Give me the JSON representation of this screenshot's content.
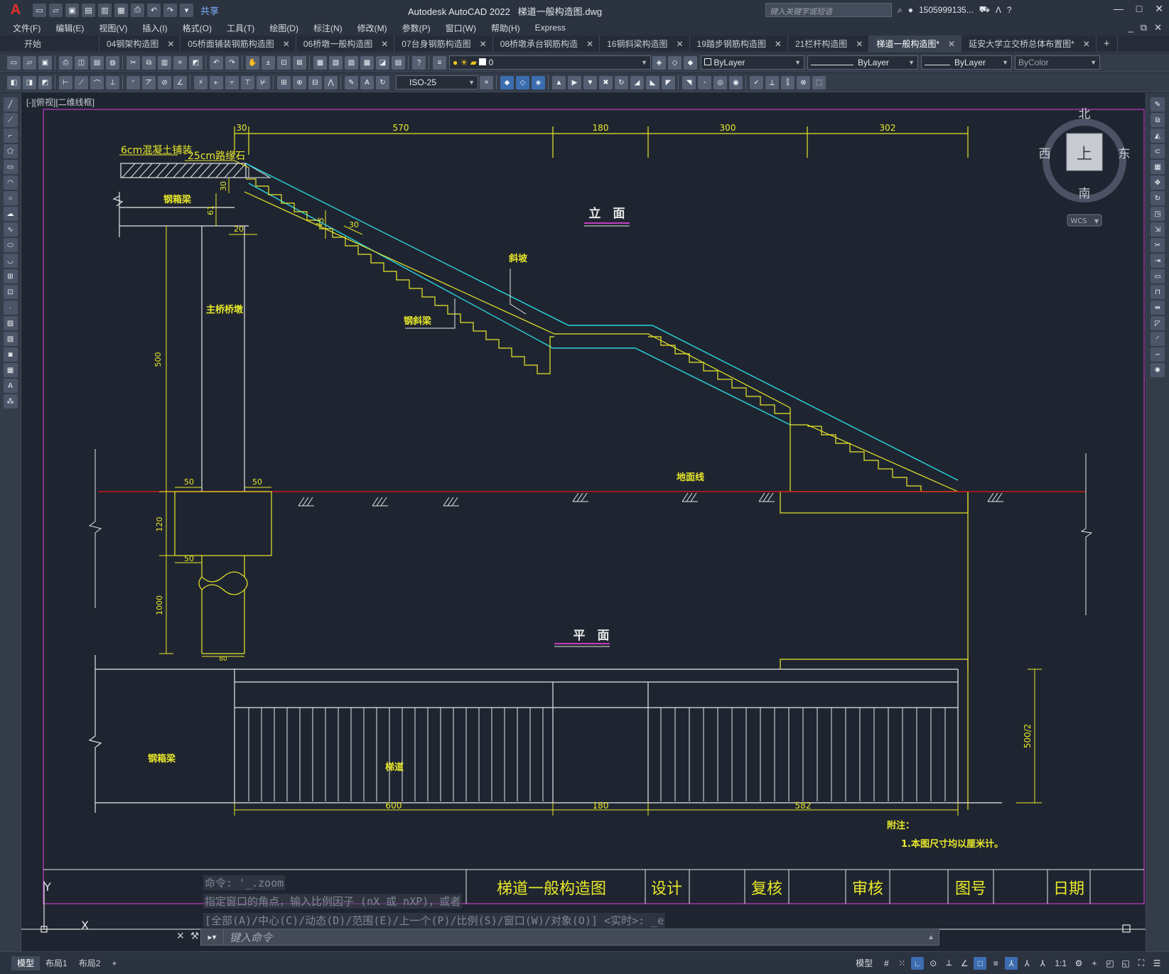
{
  "app": {
    "logo": "A",
    "title": "Autodesk AutoCAD 2022",
    "filename": "梯道一般构造图.dwg",
    "share_label": "共享",
    "search_placeholder": "键入关键字或短语",
    "user": "1505999135...",
    "window_controls": [
      "—",
      "□",
      "✕"
    ]
  },
  "menus": [
    "文件(F)",
    "编辑(E)",
    "视图(V)",
    "插入(I)",
    "格式(O)",
    "工具(T)",
    "绘图(D)",
    "标注(N)",
    "修改(M)",
    "参数(P)",
    "窗口(W)",
    "帮助(H)",
    "Express"
  ],
  "menu_right": [
    "_",
    "⧉",
    "✕"
  ],
  "tabs": [
    {
      "label": "开始",
      "closable": false
    },
    {
      "label": "04钢架构造图",
      "closable": true
    },
    {
      "label": "05桥面铺装钢筋构造图",
      "closable": true
    },
    {
      "label": "06桥墩一般构造图",
      "closable": true
    },
    {
      "label": "07台身钢筋构造图",
      "closable": true
    },
    {
      "label": "08桥墩承台钢筋构造",
      "closable": true
    },
    {
      "label": "16钢斜梁构造图",
      "closable": true
    },
    {
      "label": "19踏步钢筋构造图",
      "closable": true
    },
    {
      "label": "21栏杆构造图",
      "closable": true
    },
    {
      "label": "梯道一般构造图*",
      "closable": true,
      "active": true
    },
    {
      "label": "延安大学立交桥总体布置图*",
      "closable": true
    }
  ],
  "tab_add": "+",
  "toolbar": {
    "layer_value": "0",
    "color_value": "ByLayer",
    "linetype_value": "ByLayer",
    "lineweight_value": "ByLayer",
    "plotstyle_value": "ByColor",
    "dimstyle_value": "ISO-25"
  },
  "viewport_label": "[-][俯视][二维线框]",
  "viewcube": {
    "north": "北",
    "south": "南",
    "east": "东",
    "west": "西",
    "face": "上",
    "wcs": "WCS"
  },
  "drawing": {
    "labels": {
      "concrete_pavement": "6cm混凝土铺装",
      "curb": "25cm路缘石",
      "steel_box_girder": "钢箱梁",
      "main_pier": "主桥桥墩",
      "ramp": "斜坡",
      "steel_stringer": "钢斜梁",
      "ground_line": "地面线",
      "elevation_title": "立　面",
      "plan_title": "平　面",
      "stairway": "梯道",
      "plan_steel_box_girder": "钢箱梁",
      "note_title": "附注：",
      "note_1": "1.本图尺寸均以厘米计。"
    },
    "dims": {
      "top_30": "30",
      "top_570": "570",
      "top_180": "180",
      "top_300": "300",
      "top_302": "302",
      "d_61": "61",
      "d_30a": "30",
      "d_20": "20",
      "d_15": "15",
      "d_30b": "30",
      "d_500": "500",
      "d_50a": "50",
      "d_50b": "50",
      "d_120": "120",
      "d_50c": "50",
      "d_1000": "1000",
      "d_80": "80",
      "plan_600": "600",
      "plan_180": "180",
      "plan_582": "582",
      "plan_500_2": "500/2"
    },
    "title_block": {
      "title": "梯道一般构造图",
      "design": "设计",
      "review": "复核",
      "approve": "审核",
      "drawing_no": "图号",
      "date": "日期"
    },
    "ucs": {
      "y": "Y",
      "x": "X"
    }
  },
  "command": {
    "history": [
      "命令: '_.zoom",
      "指定窗口的角点，输入比例因子 (nX 或 nXP)，或者",
      "[全部(A)/中心(C)/动态(D)/范围(E)/上一个(P)/比例(S)/窗口(W)/对象(O)] <实时>: _e"
    ],
    "placeholder": "键入命令"
  },
  "status": {
    "layout_tabs": [
      "模型",
      "布局1",
      "布局2"
    ],
    "active_layout": "模型",
    "add_layout": "+",
    "model_label": "模型",
    "scale": "1:1"
  },
  "colors": {
    "canvas": "#1f2530",
    "yellow": "#e8e82a",
    "cyan": "#2ad4e0",
    "white": "#e6e6e6",
    "red": "#c91a1a",
    "magenta": "#c33cc3",
    "accent": "#3b6db0"
  }
}
